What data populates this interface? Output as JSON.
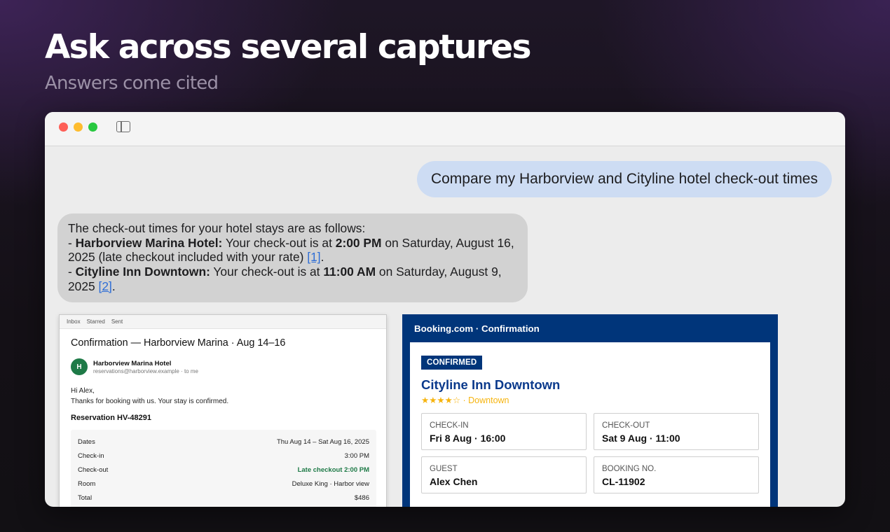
{
  "hero": {
    "title": "Ask across several captures",
    "subtitle": "Answers come cited"
  },
  "chat": {
    "user_message": "Compare my Harborview and Cityline hotel check-out times",
    "assistant": {
      "intro": "The check-out times for your hotel stays are as follows:",
      "item1_prefix": "- ",
      "item1_hotel": "Harborview Marina Hotel:",
      "item1_text_a": " Your check-out is at ",
      "item1_time": "2:00 PM",
      "item1_text_b": " on Saturday, August 16, 2025 (late checkout included with your rate) ",
      "item1_cite": "[1]",
      "item1_end": ".",
      "item2_prefix": "- ",
      "item2_hotel": "Cityline Inn Downtown:",
      "item2_text_a": " Your check-out is at ",
      "item2_time": "11:00 AM",
      "item2_text_b": " on Saturday, August 9, 2025 ",
      "item2_cite": "[2]",
      "item2_end": "."
    }
  },
  "email": {
    "nav": [
      "Inbox",
      "Starred",
      "Sent"
    ],
    "subject": "Confirmation — Harborview Marina · Aug 14–16",
    "avatar_letter": "H",
    "sender_name": "Harborview Marina Hotel",
    "sender_address": "reservations@harborview.example · to me",
    "greeting": "Hi Alex,",
    "body": "Thanks for booking with us. Your stay is confirmed.",
    "reservation": "Reservation HV-48291",
    "rows": [
      {
        "label": "Dates",
        "value": "Thu Aug 14 – Sat Aug 16, 2025"
      },
      {
        "label": "Check-in",
        "value": "3:00 PM"
      },
      {
        "label": "Check-out",
        "value": "Late checkout 2:00 PM"
      },
      {
        "label": "Room",
        "value": "Deluxe King · Harbor view"
      },
      {
        "label": "Total",
        "value": "$486"
      }
    ]
  },
  "booking": {
    "header": "Booking.com · Confirmation",
    "badge": "CONFIRMED",
    "hotel_name": "Cityline Inn Downtown",
    "rating_text": "★★★★☆ · Downtown",
    "boxes": [
      {
        "label": "CHECK-IN",
        "value": "Fri 8 Aug · 16:00"
      },
      {
        "label": "CHECK-OUT",
        "value": "Sat 9 Aug · 11:00"
      },
      {
        "label": "GUEST",
        "value": "Alex Chen"
      },
      {
        "label": "BOOKING NO.",
        "value": "CL-11902"
      }
    ]
  },
  "colors": {
    "accent_blue": "#00357a",
    "user_bubble": "#cddcf3",
    "assistant_bubble": "#d2d2d2",
    "late_checkout_green": "#1e7a47",
    "star_gold": "#f6b40e"
  }
}
